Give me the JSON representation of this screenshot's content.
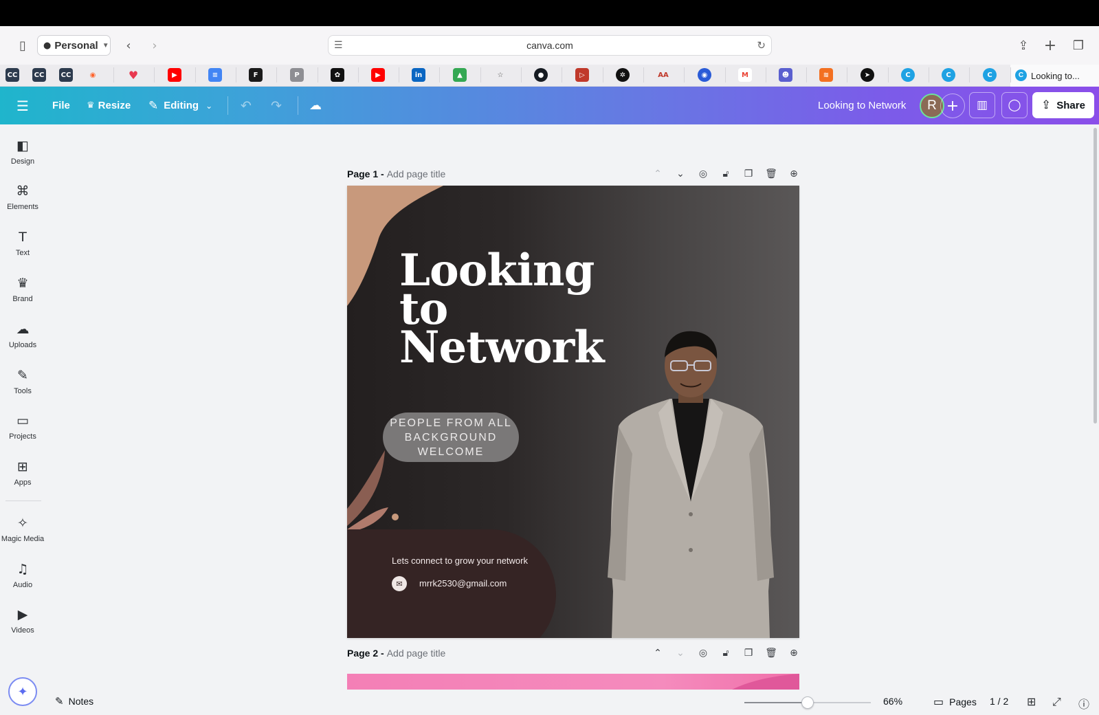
{
  "browser": {
    "profile": "Personal",
    "url": "canva.com",
    "active_tab_title": "Looking to..."
  },
  "bookmarks": [
    {
      "icon": "bookmark-1-icon",
      "label": "CC",
      "color": "#2d3b4e"
    },
    {
      "icon": "bookmark-2-icon",
      "label": "CC",
      "color": "#2d3b4e"
    },
    {
      "icon": "bookmark-3-icon",
      "label": "CC",
      "color": "#2d3b4e"
    },
    {
      "icon": "semrush-icon",
      "label": "◉",
      "color": "#ff642d"
    },
    {
      "icon": "heart-icon",
      "label": "♥",
      "color": "#e8384f"
    },
    {
      "icon": "youtube-icon",
      "label": "▶",
      "color": "#ff0000"
    },
    {
      "icon": "docs-icon",
      "label": "≡",
      "color": "#4285f4"
    },
    {
      "icon": "fiverr-icon",
      "label": "F",
      "color": "#1a1a1a"
    },
    {
      "icon": "p-icon",
      "label": "P",
      "color": "#8e8e93"
    },
    {
      "icon": "openai-icon",
      "label": "✿",
      "color": "#111111"
    },
    {
      "icon": "youtube-2-icon",
      "label": "▶",
      "color": "#ff0000"
    },
    {
      "icon": "linkedin-icon",
      "label": "in",
      "color": "#0a66c2"
    },
    {
      "icon": "drive-icon",
      "label": "▲",
      "color": "#34a853"
    },
    {
      "icon": "star-icon",
      "label": "☆",
      "color": "#ecebee"
    },
    {
      "icon": "github-icon",
      "label": "●",
      "color": "#161b22"
    },
    {
      "icon": "play-icon",
      "label": "▷",
      "color": "#c0392b"
    },
    {
      "icon": "chatgpt-icon",
      "label": "✲",
      "color": "#111111"
    },
    {
      "icon": "aa-icon",
      "label": "AA",
      "color": "#ecebee"
    },
    {
      "icon": "shield-icon",
      "label": "◉",
      "color": "#2a5bd7"
    },
    {
      "icon": "gmail-icon",
      "label": "M",
      "color": "#ffffff"
    },
    {
      "icon": "robot-icon",
      "label": "☻",
      "color": "#5a5fcf"
    },
    {
      "icon": "stack-icon",
      "label": "≋",
      "color": "#f37021"
    },
    {
      "icon": "telegram-icon",
      "label": "➤",
      "color": "#111111"
    },
    {
      "icon": "canva-1-icon",
      "label": "C",
      "color": "#1fa2e3"
    },
    {
      "icon": "canva-2-icon",
      "label": "C",
      "color": "#1fa2e3"
    },
    {
      "icon": "canva-3-icon",
      "label": "C",
      "color": "#1fa2e3"
    }
  ],
  "canva_header": {
    "file": "File",
    "resize": "Resize",
    "editing": "Editing",
    "doc_title": "Looking to Network",
    "avatar_initial": "R",
    "share": "Share"
  },
  "sidebar": {
    "items": [
      {
        "label": "Design",
        "icon": "design-icon",
        "glyph": "◧"
      },
      {
        "label": "Elements",
        "icon": "elements-icon",
        "glyph": "⌘"
      },
      {
        "label": "Text",
        "icon": "text-icon",
        "glyph": "T"
      },
      {
        "label": "Brand",
        "icon": "brand-icon",
        "glyph": "♛"
      },
      {
        "label": "Uploads",
        "icon": "uploads-icon",
        "glyph": "☁"
      },
      {
        "label": "Tools",
        "icon": "tools-icon",
        "glyph": "✎"
      },
      {
        "label": "Projects",
        "icon": "projects-icon",
        "glyph": "▭"
      },
      {
        "label": "Apps",
        "icon": "apps-icon",
        "glyph": "⊞"
      },
      {
        "label": "Magic Media",
        "icon": "magic-media-icon",
        "glyph": "✧"
      },
      {
        "label": "Audio",
        "icon": "audio-icon",
        "glyph": "♫"
      },
      {
        "label": "Videos",
        "icon": "videos-icon",
        "glyph": "▶"
      }
    ]
  },
  "pages": [
    {
      "number": "Page 1 -",
      "title_placeholder": "Add page title"
    },
    {
      "number": "Page 2 -",
      "title_placeholder": "Add page title"
    }
  ],
  "design": {
    "title": "Looking\nto\nNetwork",
    "pill": "PEOPLE FROM ALL BACKGROUND WELCOME",
    "tagline": "Lets connect to grow your network",
    "email": "mrrk2530@gmail.com",
    "colors": {
      "background": "#2c2828",
      "accent": "#c8997c",
      "card": "#352424"
    }
  },
  "bottom": {
    "notes": "Notes",
    "zoom": "66%",
    "zoom_level": 0.5,
    "pages": "Pages",
    "page_count": "1 / 2"
  }
}
